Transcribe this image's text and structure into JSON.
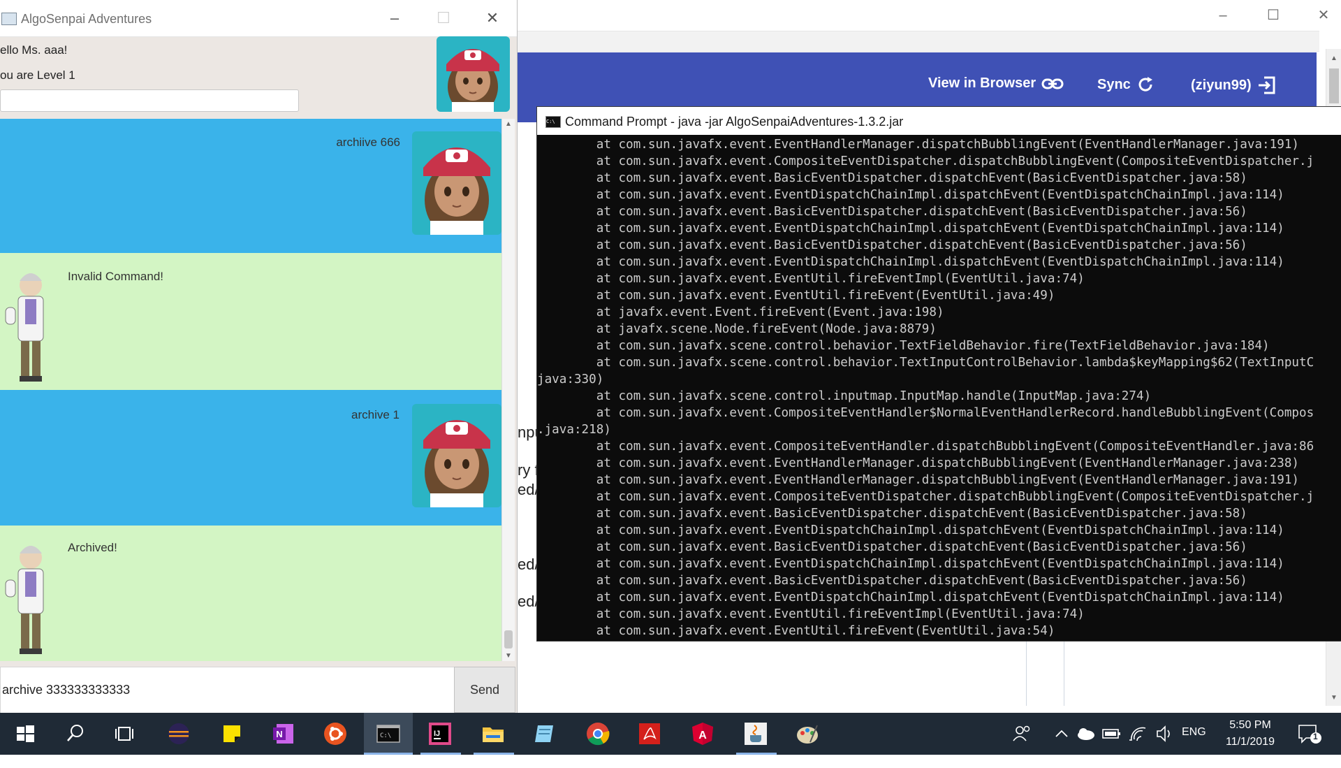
{
  "background_window": {
    "nav": {
      "view_in_browser": "View in Browser",
      "sync": "Sync",
      "account": "(ziyun99)"
    },
    "fragments": [
      "npu",
      "ry f",
      "ed/",
      "ed/",
      "ed/"
    ]
  },
  "chat_window": {
    "title": "AlgoSenpai Adventures",
    "greeting": "ello Ms. aaa!",
    "level": "ou are Level 1",
    "messages": [
      {
        "sender": "user",
        "text": "archiive 666"
      },
      {
        "sender": "bot",
        "text": "Invalid Command!"
      },
      {
        "sender": "user",
        "text": "archive 1"
      },
      {
        "sender": "bot",
        "text": "Archived!"
      }
    ],
    "input_value": "archive 333333333333",
    "send_label": "Send"
  },
  "command_prompt": {
    "title": "Command Prompt - java  -jar AlgoSenpaiAdventures-1.3.2.jar",
    "lines": [
      "        at com.sun.javafx.event.EventHandlerManager.dispatchBubblingEvent(EventHandlerManager.java:191)",
      "        at com.sun.javafx.event.CompositeEventDispatcher.dispatchBubblingEvent(CompositeEventDispatcher.j",
      "        at com.sun.javafx.event.BasicEventDispatcher.dispatchEvent(BasicEventDispatcher.java:58)",
      "        at com.sun.javafx.event.EventDispatchChainImpl.dispatchEvent(EventDispatchChainImpl.java:114)",
      "        at com.sun.javafx.event.BasicEventDispatcher.dispatchEvent(BasicEventDispatcher.java:56)",
      "        at com.sun.javafx.event.EventDispatchChainImpl.dispatchEvent(EventDispatchChainImpl.java:114)",
      "        at com.sun.javafx.event.BasicEventDispatcher.dispatchEvent(BasicEventDispatcher.java:56)",
      "        at com.sun.javafx.event.EventDispatchChainImpl.dispatchEvent(EventDispatchChainImpl.java:114)",
      "        at com.sun.javafx.event.EventUtil.fireEventImpl(EventUtil.java:74)",
      "        at com.sun.javafx.event.EventUtil.fireEvent(EventUtil.java:49)",
      "        at javafx.event.Event.fireEvent(Event.java:198)",
      "        at javafx.scene.Node.fireEvent(Node.java:8879)",
      "        at com.sun.javafx.scene.control.behavior.TextFieldBehavior.fire(TextFieldBehavior.java:184)",
      "        at com.sun.javafx.scene.control.behavior.TextInputControlBehavior.lambda$keyMapping$62(TextInputC",
      "java:330)",
      "        at com.sun.javafx.scene.control.inputmap.InputMap.handle(InputMap.java:274)",
      "        at com.sun.javafx.event.CompositeEventHandler$NormalEventHandlerRecord.handleBubblingEvent(Compos",
      ".java:218)",
      "        at com.sun.javafx.event.CompositeEventHandler.dispatchBubblingEvent(CompositeEventHandler.java:86",
      "        at com.sun.javafx.event.EventHandlerManager.dispatchBubblingEvent(EventHandlerManager.java:238)",
      "        at com.sun.javafx.event.EventHandlerManager.dispatchBubblingEvent(EventHandlerManager.java:191)",
      "        at com.sun.javafx.event.CompositeEventDispatcher.dispatchBubblingEvent(CompositeEventDispatcher.j",
      "        at com.sun.javafx.event.BasicEventDispatcher.dispatchEvent(BasicEventDispatcher.java:58)",
      "        at com.sun.javafx.event.EventDispatchChainImpl.dispatchEvent(EventDispatchChainImpl.java:114)",
      "        at com.sun.javafx.event.BasicEventDispatcher.dispatchEvent(BasicEventDispatcher.java:56)",
      "        at com.sun.javafx.event.EventDispatchChainImpl.dispatchEvent(EventDispatchChainImpl.java:114)",
      "        at com.sun.javafx.event.BasicEventDispatcher.dispatchEvent(BasicEventDispatcher.java:56)",
      "        at com.sun.javafx.event.EventDispatchChainImpl.dispatchEvent(EventDispatchChainImpl.java:114)",
      "        at com.sun.javafx.event.EventUtil.fireEventImpl(EventUtil.java:74)",
      "        at com.sun.javafx.event.EventUtil.fireEvent(EventUtil.java:54)"
    ]
  },
  "taskbar": {
    "icons": [
      "windows-start-icon",
      "search-icon",
      "task-view-icon",
      "eclipse-icon",
      "sticky-notes-icon",
      "onenote-icon",
      "ubuntu-icon",
      "command-prompt-icon",
      "intellij-icon",
      "file-explorer-icon",
      "notepad-icon",
      "chrome-icon",
      "acrobat-icon",
      "angular-icon",
      "java-icon",
      "paint-icon"
    ],
    "tray": {
      "language": "ENG",
      "time": "5:50 PM",
      "date": "11/1/2019",
      "notification_count": "1"
    }
  },
  "colors": {
    "user_bubble": "#3ab3ea",
    "bot_bubble": "#d3f5c4",
    "header_blue": "#3f51b5",
    "console_bg": "#0c0c0c",
    "taskbar_bg": "#1f2a36"
  }
}
